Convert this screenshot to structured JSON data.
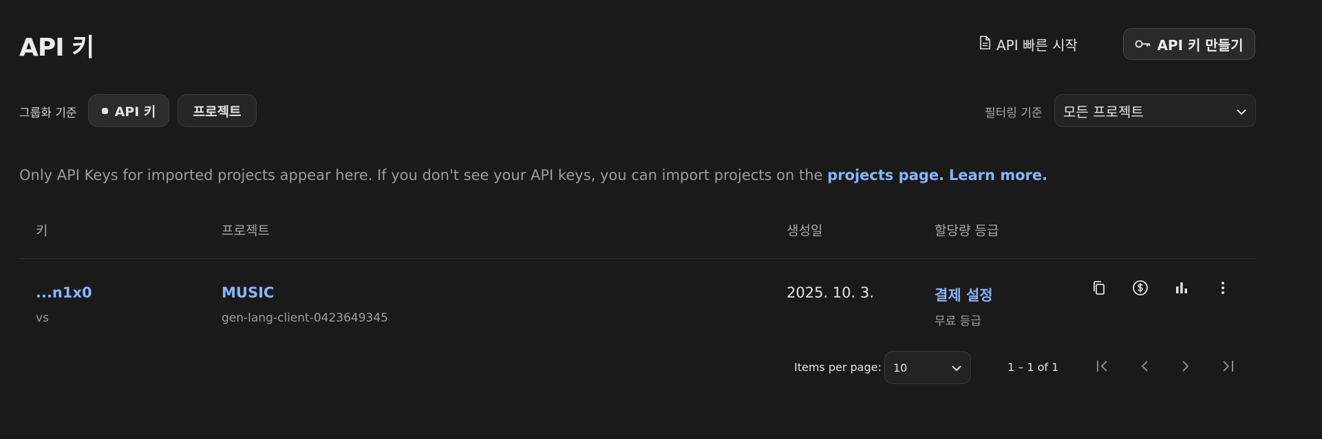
{
  "header": {
    "title": "API 키",
    "quickstart_label": "API 빠른 시작",
    "create_key_label": "API 키 만들기"
  },
  "group_by": {
    "label": "그룹화 기준",
    "options": [
      "API 키",
      "프로젝트"
    ],
    "selected": "API 키"
  },
  "filter": {
    "label": "필터링 기준",
    "value": "모든 프로젝트"
  },
  "notice": {
    "text": "Only API Keys for imported projects appear here. If you don't see your API keys, you can import projects on the ",
    "link_projects": "projects page.",
    "link_learn": "Learn more."
  },
  "table": {
    "headers": [
      "키",
      "프로젝트",
      "생성일",
      "할당량 등급"
    ],
    "rows": [
      {
        "key": "...n1x0",
        "key_name": "vs",
        "project": "MUSIC",
        "project_id": "gen-lang-client-0423649345",
        "created": "2025. 10. 3.",
        "quota_action": "결제 설정",
        "quota_tier": "무료 등급"
      }
    ],
    "row_actions": [
      "copy-icon",
      "billing-dollar-icon",
      "bar-chart-icon",
      "more-vert-icon"
    ]
  },
  "pagination": {
    "items_per_page_label": "Items per page:",
    "items_per_page": "10",
    "range": "1 – 1 of 1"
  },
  "colors": {
    "background": "#1a1a1a",
    "link": "#8ab4f8",
    "text": "#e3e3e3",
    "muted": "#9e9e9e"
  }
}
